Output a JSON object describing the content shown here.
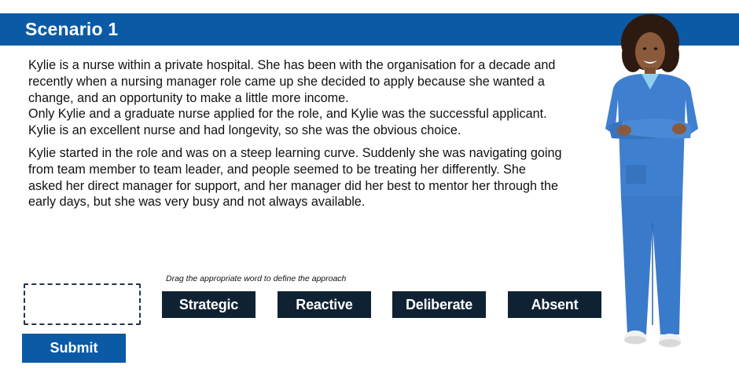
{
  "header": {
    "title": "Scenario 1"
  },
  "scenario": {
    "paragraph1": [
      "Kylie is a nurse within a private hospital. She has been with the organisation for a decade and",
      "recently when a nursing manager role came up she decided to apply because she wanted a",
      "change, and an opportunity to make a little more income.",
      "Only Kylie and a graduate nurse applied for the role, and Kylie was the successful applicant.",
      "Kylie is an excellent nurse and had longevity, so she was the obvious choice."
    ],
    "paragraph2": [
      "Kylie started in the role and was on a steep learning curve. Suddenly she was navigating going",
      "from team member to team leader, and people seemed to be treating her differently. She",
      "asked her direct manager for support, and her manager did her best to mentor her through the",
      "early days, but she was very busy and not always available."
    ]
  },
  "activity": {
    "instruction": "Drag the appropriate word to define the approach",
    "options": [
      "Strategic",
      "Reactive",
      "Deliberate",
      "Absent"
    ],
    "submit_label": "Submit"
  },
  "colors": {
    "header_blue": "#0b5aa5",
    "option_navy": "#0f2233",
    "drop_border": "#1f3350",
    "scrubs_blue": "#3f7fcf"
  }
}
